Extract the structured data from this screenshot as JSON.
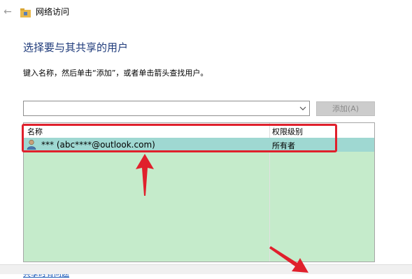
{
  "window": {
    "title": "网络访问"
  },
  "heading": "选择要与其共享的用户",
  "instruction": "键入名称，然后单击“添加”，或者单击箭头查找用户。",
  "add_input": {
    "value": "",
    "placeholder": ""
  },
  "add_button": "添加(A)",
  "table": {
    "headers": {
      "name": "名称",
      "level": "权限级别"
    },
    "rows": [
      {
        "name": "*** (abc****@outlook.com)",
        "level": "所有者"
      }
    ]
  },
  "help_link": "共享时有问题",
  "colors": {
    "heading": "#1e3a7a",
    "row_selected": "#9fd8d2",
    "table_bg": "#c5ebcb",
    "annotation": "#e0202c"
  }
}
